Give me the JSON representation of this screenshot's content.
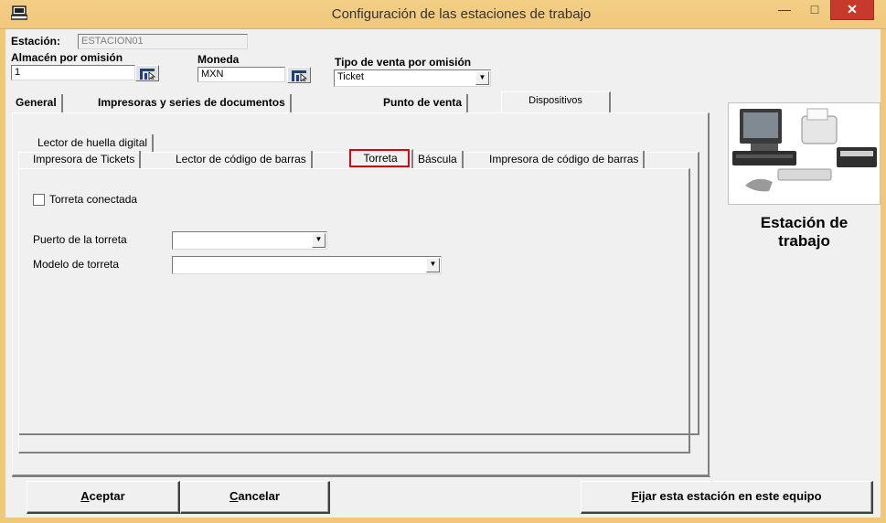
{
  "window": {
    "title": "Configuración de las estaciones de trabajo",
    "min_glyph": "—",
    "max_glyph": "□",
    "close_glyph": "✕"
  },
  "station": {
    "label": "Estación:",
    "value": "ESTACION01"
  },
  "warehouse": {
    "label": "Almacén por omisión",
    "value": "1"
  },
  "currency": {
    "label": "Moneda",
    "value": "MXN"
  },
  "sale_type": {
    "label": "Tipo de venta por omisión",
    "value": "Ticket"
  },
  "main_tabs": [
    {
      "label": "General"
    },
    {
      "label": "Impresoras  y series de documentos"
    },
    {
      "label": "Punto de venta"
    },
    {
      "label": "Dispositivos"
    }
  ],
  "device_tabs_row1": [
    {
      "label": "Lector de huella digital"
    }
  ],
  "device_tabs_row2": [
    {
      "label": "Impresora de Tickets"
    },
    {
      "label": "Lector de código de barras"
    },
    {
      "label": "Torreta"
    },
    {
      "label": "Báscula"
    },
    {
      "label": "Impresora de código de barras"
    }
  ],
  "torreta": {
    "connected_label": "Torreta conectada",
    "connected": false,
    "port_label": "Puerto de la torreta",
    "port_value": "",
    "model_label": "Modelo de torreta",
    "model_value": ""
  },
  "side": {
    "caption_line1": "Estación de",
    "caption_line2": "trabajo"
  },
  "buttons": {
    "accept_prefix": "A",
    "accept_rest": "ceptar",
    "cancel_prefix": "C",
    "cancel_rest": "ancelar",
    "fix_prefix": "F",
    "fix_rest": "ijar esta estación en este equipo"
  },
  "colors": {
    "titlebar": "#f0c87c",
    "close": "#c7392b",
    "highlight": "#e3000f"
  }
}
